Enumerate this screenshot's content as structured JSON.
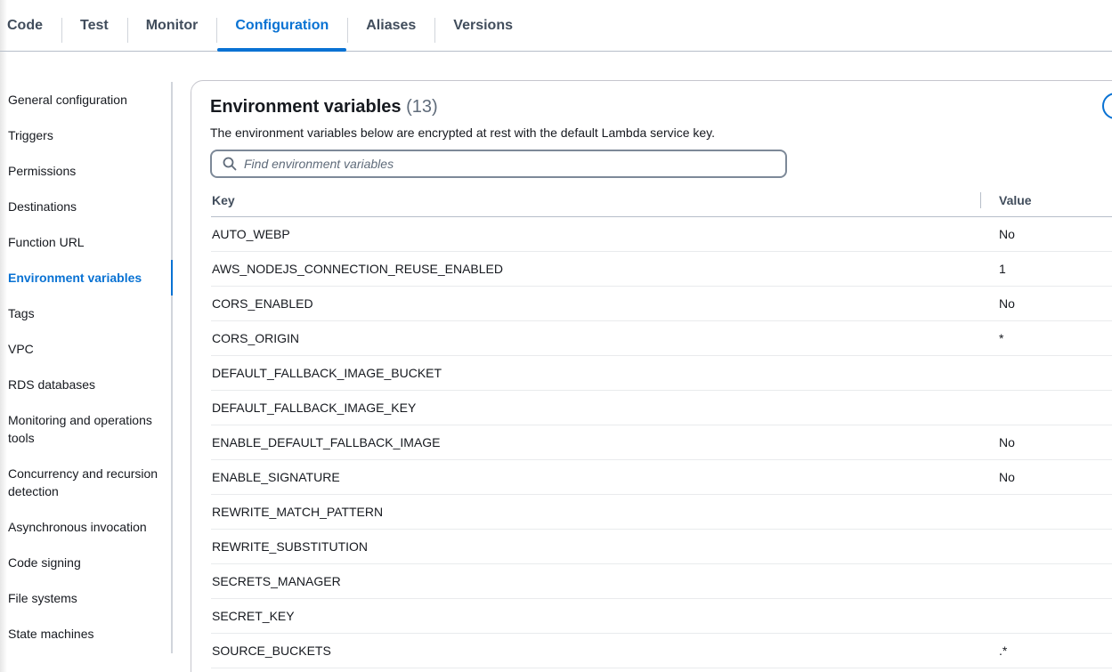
{
  "tabs": [
    {
      "label": "Code",
      "active": false
    },
    {
      "label": "Test",
      "active": false
    },
    {
      "label": "Monitor",
      "active": false
    },
    {
      "label": "Configuration",
      "active": true
    },
    {
      "label": "Aliases",
      "active": false
    },
    {
      "label": "Versions",
      "active": false
    }
  ],
  "sidebar": {
    "items": [
      {
        "label": "General configuration"
      },
      {
        "label": "Triggers"
      },
      {
        "label": "Permissions"
      },
      {
        "label": "Destinations"
      },
      {
        "label": "Function URL"
      },
      {
        "label": "Environment variables",
        "active": true
      },
      {
        "label": "Tags"
      },
      {
        "label": "VPC"
      },
      {
        "label": "RDS databases"
      },
      {
        "label": "Monitoring and operations tools"
      },
      {
        "label": "Concurrency and recursion detection"
      },
      {
        "label": "Asynchronous invocation"
      },
      {
        "label": "Code signing"
      },
      {
        "label": "File systems"
      },
      {
        "label": "State machines"
      }
    ]
  },
  "panel": {
    "title": "Environment variables",
    "count": "(13)",
    "description": "The environment variables below are encrypted at rest with the default Lambda service key.",
    "search_placeholder": "Find environment variables"
  },
  "table": {
    "columns": {
      "key": "Key",
      "value": "Value"
    },
    "rows": [
      {
        "key": "AUTO_WEBP",
        "value": "No"
      },
      {
        "key": "AWS_NODEJS_CONNECTION_REUSE_ENABLED",
        "value": "1"
      },
      {
        "key": "CORS_ENABLED",
        "value": "No"
      },
      {
        "key": "CORS_ORIGIN",
        "value": "*"
      },
      {
        "key": "DEFAULT_FALLBACK_IMAGE_BUCKET",
        "value": ""
      },
      {
        "key": "DEFAULT_FALLBACK_IMAGE_KEY",
        "value": ""
      },
      {
        "key": "ENABLE_DEFAULT_FALLBACK_IMAGE",
        "value": "No"
      },
      {
        "key": "ENABLE_SIGNATURE",
        "value": "No"
      },
      {
        "key": "REWRITE_MATCH_PATTERN",
        "value": ""
      },
      {
        "key": "REWRITE_SUBSTITUTION",
        "value": ""
      },
      {
        "key": "SECRETS_MANAGER",
        "value": ""
      },
      {
        "key": "SECRET_KEY",
        "value": ""
      },
      {
        "key": "SOURCE_BUCKETS",
        "value": ".*"
      }
    ]
  },
  "colors": {
    "accent": "#0972d3",
    "text": "#16191f",
    "muted": "#5f6b7a",
    "border": "#b6bec9"
  },
  "icons": {
    "search": "search-icon"
  }
}
